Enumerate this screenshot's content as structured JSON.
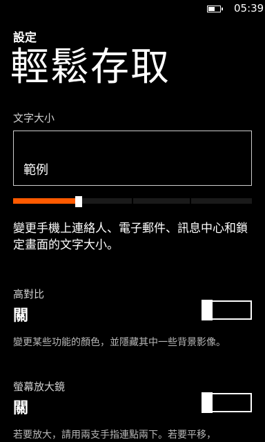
{
  "status": {
    "time": "05:39",
    "battery_level": 0.6
  },
  "header": {
    "app_title": "設定",
    "page_title": "輕鬆存取"
  },
  "text_size": {
    "label": "文字大小",
    "sample": "範例",
    "slider_value": 0.26,
    "description": "變更手機上連絡人、電子郵件、訊息中心和鎖定畫面的文字大小。"
  },
  "high_contrast": {
    "label": "高對比",
    "state": "關",
    "on": false,
    "description": "變更某些功能的顏色，並隱藏其中一些背景影像。"
  },
  "magnifier": {
    "label": "螢幕放大鏡",
    "state": "關",
    "on": false,
    "description": "若要放大，請用兩支手指連點兩下。若要平移，"
  },
  "colors": {
    "accent": "#ff5a00",
    "background": "#000000",
    "foreground": "#ffffff"
  }
}
